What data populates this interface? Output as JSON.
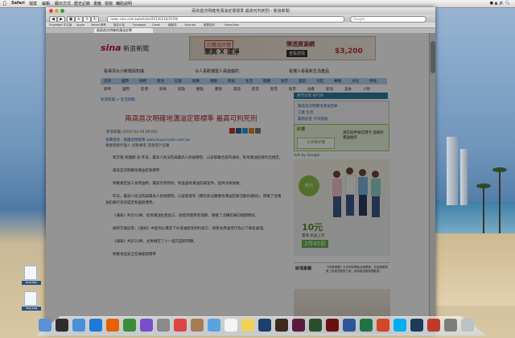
{
  "menubar": {
    "app": "Safari",
    "items": [
      "檔案",
      "編輯",
      "顯示方式",
      "歷史記錄",
      "書籤",
      "視窗",
      "輔助說明"
    ]
  },
  "window": {
    "title": "兩高首次明確地溝油定罪標準 最高可判死刑 - 新浪新聞"
  },
  "toolbar": {
    "address": "news.sina.com.tw/article/20120216/3159/",
    "search_placeholder": "Google"
  },
  "bookmarks": [
    "Engadget 中文版",
    "Apple",
    "Yahoo!奇摩",
    "無名小站",
    "Facebook",
    "Gmail",
    "痞客邦",
    "Youtube",
    "維基百科",
    "NewsView"
  ],
  "tabs": {
    "active": "兩高首次明確地溝油定罪"
  },
  "page": {
    "logo": "sina",
    "logo_sub": "新浪新聞",
    "banner": {
      "tag": "訂購送好禮",
      "line1": "樂高 X 速淨",
      "brand": "樂透資源網",
      "button": "查看詳情",
      "price": "$3,200"
    },
    "top_links": [
      "看得清大小新聞與知識",
      "令人喜歡博愛人員遊戲的",
      "看慣人看看新生活產品"
    ],
    "nav": [
      "首頁",
      "國際",
      "財經",
      "政治",
      "社會",
      "娛樂",
      "運動",
      "科技",
      "生活",
      "健康",
      "地方",
      "旅遊",
      "大陸",
      "專題",
      "文化",
      "時尚"
    ],
    "subnav": [
      "即時",
      "國際",
      "陸港",
      "新奇",
      "焦點",
      "觀點",
      "體育",
      "旅遊",
      "影音",
      "影音",
      "股市",
      "地產",
      "新浪",
      "美食",
      "人物"
    ],
    "breadcrumb": "新浪新聞 > 生活新聞",
    "headline": "兩高首次明確地溝油定罪標準 最高可判死刑",
    "meta": "新浪新聞  (2012-02-16 09:00)",
    "ad_line1": "免費諮詢 - 最優退稅服務 www.taxprovide.com.tw",
    "ad_line2": "專業稅務代理人  退稅專家 百萬客戶信賴",
    "paragraphs": [
      "新京報 新聞網 訊 昨日，最高人民法院與最高人民檢察院、公安部聯合發布通知，對地溝油犯罪作出規定。",
      "兩高首次明確地溝油定罪標準",
      "明確規定加工食用油時，最高可判死刑，對查處地溝油犯罪案件，提供法律依據。",
      "昨日，最高人民法院與最高人民檢察院、公安部發布《關於依法嚴懲地溝油犯罪活動的通知》，明確了地溝油犯罪行為的認定和處罰標準。",
      "《通知》共計22條，從地溝油生產加工、銷售到使用等環節，明確了涉嫌犯罪的相關情形。",
      "據新京報記者，《通知》中提到以溝及下水道油脂等材料加工、銷售食用油等行為以下罪名處理。",
      "《通知》共計22條，主要規定了十一個方面的問題。",
      "明確食品安全犯罪處罰標準"
    ],
    "side": {
      "bar": "熱門文章 排行榜",
      "links": [
        "兩高首次明確地溝油定罪",
        "工業 生活",
        "最新訊息 今日焦點"
      ],
      "promo_title": "好禮",
      "promo_box": "分享拿好禮",
      "promo_text": "現在就申請信用卡 首刷好禮送給您",
      "ads_by": "Ads by Google",
      "ad_circle": "新光",
      "ad_big": "10元",
      "ad_sub": "夏季 新品上市",
      "ad_price": "2件85折",
      "ad3_head": "好消息報",
      "ad3_text": "【政策調整】今天明年開始全面實施，在各產業政策上有更多應對方案，請持續追蹤新聞動態。"
    }
  },
  "desktop_icons": [
    "sina.doc",
    "img.png"
  ],
  "dock_icons": [
    "finder-icon",
    "dashboard-icon",
    "mail-icon",
    "safari-icon",
    "firefox-icon",
    "chrome-icon",
    "itunes-icon",
    "photo-icon",
    "calendar-icon",
    "address-book-icon",
    "preview-icon",
    "textedit-icon",
    "notes-icon",
    "photoshop-icon",
    "illustrator-icon",
    "indesign-icon",
    "dreamweaver-icon",
    "flash-icon",
    "word-icon",
    "excel-icon",
    "powerpoint-icon",
    "skype-icon",
    "world-of-warcraft-icon",
    "parallels-icon",
    "system-preferences-icon",
    "trash-icon"
  ],
  "colors": {
    "sina_red": "#c8102e",
    "headline": "#b0272b",
    "link": "#1a5fb4",
    "nav_bar": "#b9d3ec"
  }
}
